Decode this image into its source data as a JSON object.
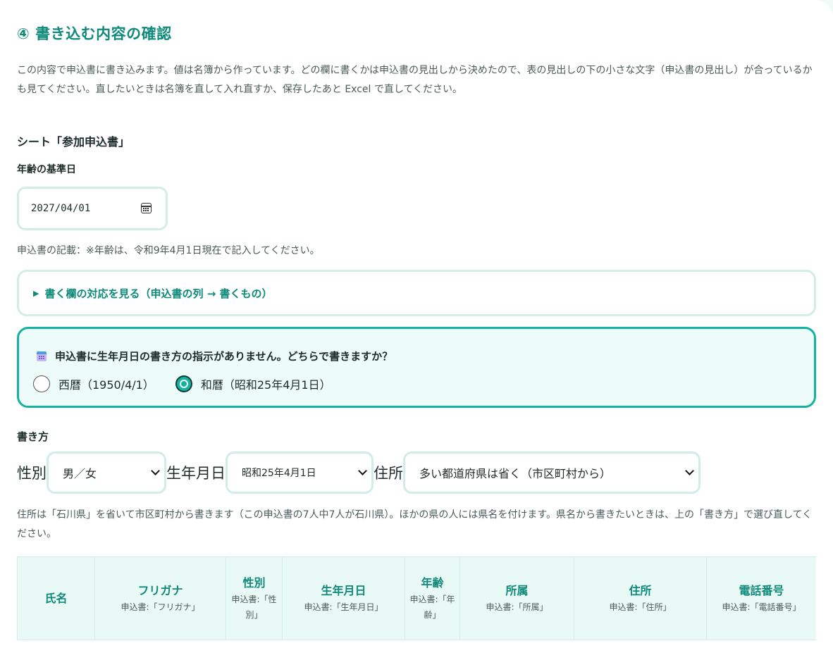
{
  "section": {
    "title": "④ 書き込む内容の確認",
    "intro": "この内容で申込書に書き込みます。値は名簿から作っています。どの欄に書くかは申込書の見出しから決めたので、表の見出しの下の小さな文字（申込書の見出し）が合っているかも見てください。直したいときは名簿を直して入れ直すか、保存したあと Excel で直してください。"
  },
  "sheet": {
    "heading": "シート「参加申込書」"
  },
  "age_base": {
    "label": "年齢の基準日",
    "value": "2027/04/01",
    "note": "申込書の記載：※年齢は、令和9年4月1日現在で記入してください。"
  },
  "mapping": {
    "summary": "書く欄の対応を見る（申込書の列 → 書くもの）"
  },
  "birth_format": {
    "question": "申込書に生年月日の書き方の指示がありません。どちらで書きますか？",
    "options": [
      {
        "label": "西暦（1950/4/1）",
        "checked": false
      },
      {
        "label": "和暦（昭和25年4月1日）",
        "checked": true
      }
    ]
  },
  "howto": {
    "label": "書き方",
    "gender_label": "性別",
    "gender_value": "男／女",
    "birth_label": "生年月日",
    "birth_value": "昭和25年4月1日",
    "address_label": "住所",
    "address_value": "多い都道府県は省く（市区町村から）",
    "note": "住所は「石川県」を省いて市区町村から書きます（この申込書の7人中7人が石川県）。ほかの県の人には県名を付けます。県名から書きたいときは、上の「書き方」で選び直してください。"
  },
  "table": {
    "columns": [
      {
        "header": "氏名",
        "sub": ""
      },
      {
        "header": "フリガナ",
        "sub": "申込書:「フリガナ」"
      },
      {
        "header": "性別",
        "sub": "申込書:「性別」"
      },
      {
        "header": "生年月日",
        "sub": "申込書:「生年月日」"
      },
      {
        "header": "年齢",
        "sub": "申込書:「年齢」"
      },
      {
        "header": "所属",
        "sub": "申込書:「所属」"
      },
      {
        "header": "住所",
        "sub": "申込書:「住所」"
      },
      {
        "header": "電話番号",
        "sub": "申込書:「電話番号」"
      }
    ]
  },
  "colors": {
    "accent": "#0f8a7a",
    "accent_bright": "#14b3a0",
    "border": "#d2ece7",
    "header_bg": "#e9f9f5"
  }
}
